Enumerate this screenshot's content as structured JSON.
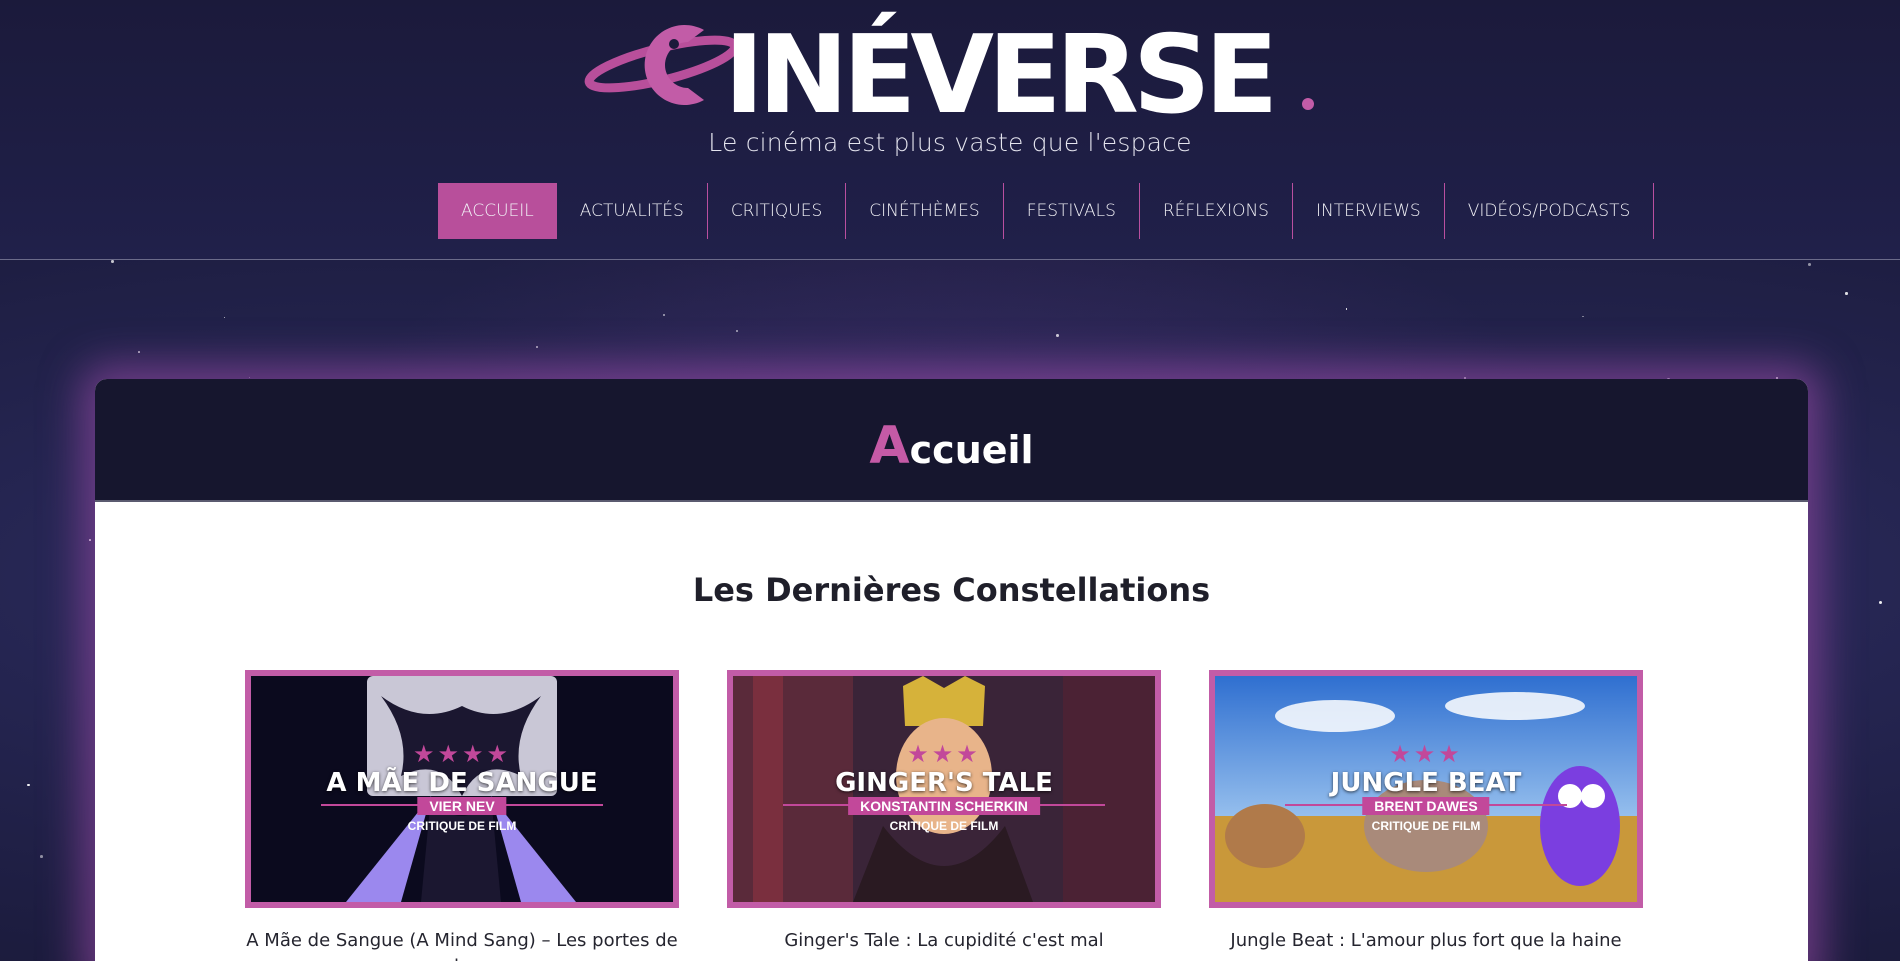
{
  "site": {
    "logo_text": "CINÉVERSE",
    "tagline": "Le cinéma est plus vaste que l'espace"
  },
  "nav": {
    "items": [
      {
        "label": "ACCUEIL",
        "active": true
      },
      {
        "label": "ACTUALITÉS"
      },
      {
        "label": "CRITIQUES"
      },
      {
        "label": "CINÉTHÈMES"
      },
      {
        "label": "FESTIVALS"
      },
      {
        "label": "RÉFLEXIONS"
      },
      {
        "label": "INTERVIEWS"
      },
      {
        "label": "VIDÉOS/PODCASTS"
      }
    ]
  },
  "page": {
    "title_first_letter": "A",
    "title_rest": "ccueil",
    "section_title": "Les Dernières Constellations"
  },
  "posts": [
    {
      "thumb_title": "A MÃE DE SANGUE",
      "director": "VIER NEV",
      "kind": "CRITIQUE DE FILM",
      "rating": 4,
      "title": "A Mãe de Sangue (A Mind Sang) – Les portes de la"
    },
    {
      "thumb_title": "GINGER'S TALE",
      "director": "KONSTANTIN SCHERKIN",
      "kind": "CRITIQUE DE FILM",
      "rating": 2.5,
      "title": "Ginger's Tale : La cupidité c'est mal"
    },
    {
      "thumb_title": "JUNGLE BEAT",
      "director": "BRENT DAWES",
      "kind": "CRITIQUE DE FILM",
      "rating": 2.5,
      "title": "Jungle Beat : L'amour plus fort que la haine"
    }
  ],
  "colors": {
    "accent": "#c2489a",
    "header_bg": "#1b1a3b",
    "card_head_bg": "#16162e"
  }
}
